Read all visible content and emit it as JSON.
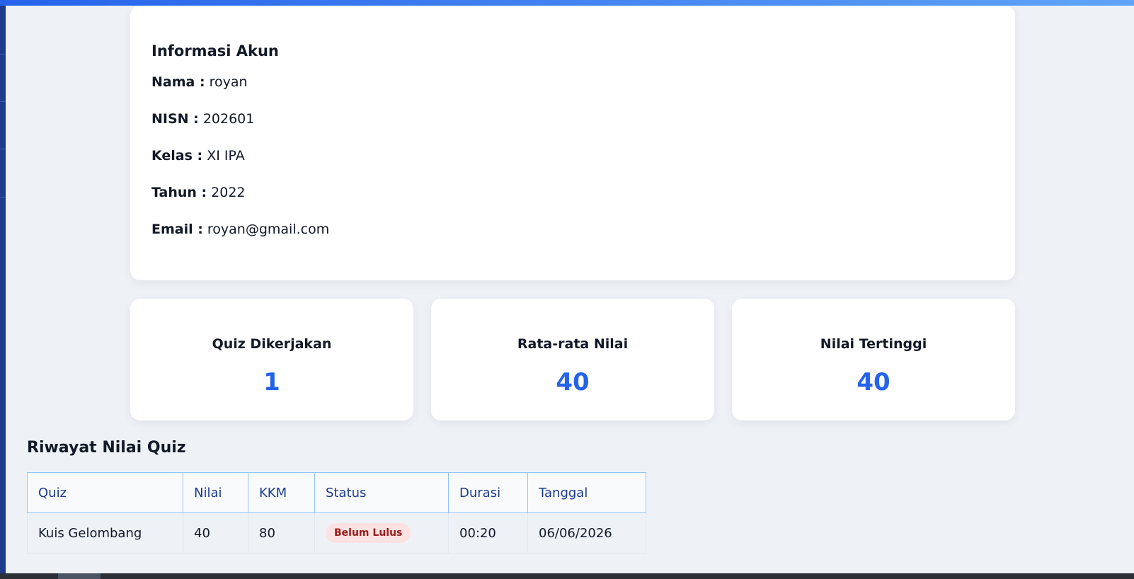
{
  "account": {
    "title": "Informasi Akun",
    "fields": [
      {
        "label": "Nama :",
        "value": "royan"
      },
      {
        "label": "NISN :",
        "value": "202601"
      },
      {
        "label": "Kelas :",
        "value": "XI IPA"
      },
      {
        "label": "Tahun :",
        "value": "2022"
      },
      {
        "label": "Email :",
        "value": "royan@gmail.com"
      }
    ]
  },
  "stats": [
    {
      "label": "Quiz Dikerjakan",
      "value": "1"
    },
    {
      "label": "Rata-rata Nilai",
      "value": "40"
    },
    {
      "label": "Nilai Tertinggi",
      "value": "40"
    }
  ],
  "history": {
    "title": "Riwayat Nilai Quiz",
    "columns": [
      "Quiz",
      "Nilai",
      "KKM",
      "Status",
      "Durasi",
      "Tanggal"
    ],
    "rows": [
      {
        "quiz": "Kuis Gelombang",
        "nilai": "40",
        "kkm": "80",
        "status": "Belum Lulus",
        "durasi": "00:20",
        "tanggal": "06/06/2026"
      }
    ]
  },
  "colors": {
    "accent": "#2563eb",
    "header_text": "#1e3a8a",
    "status_fail_bg": "#fee2e2",
    "status_fail_text": "#991b1b"
  }
}
